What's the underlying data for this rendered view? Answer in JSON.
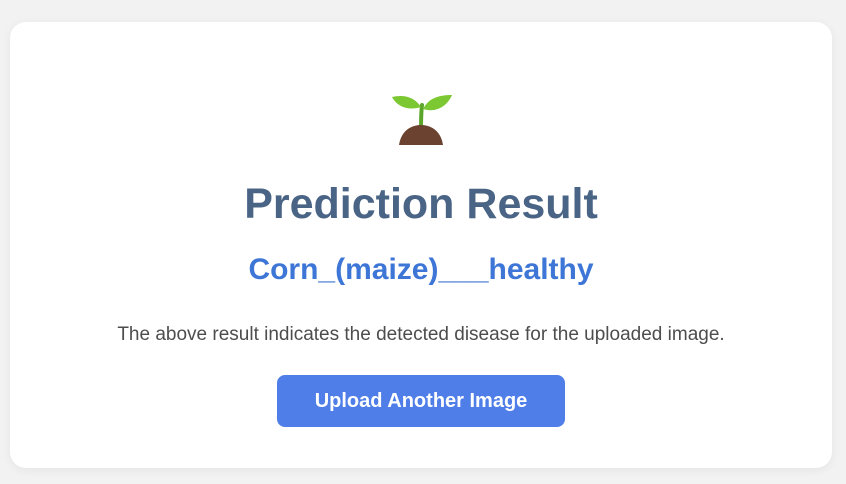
{
  "card": {
    "icon": "seedling-icon",
    "title": "Prediction Result",
    "result": "Corn_(maize)___healthy",
    "description": "The above result indicates the detected disease for the uploaded image.",
    "button_label": "Upload Another Image"
  },
  "colors": {
    "background": "#f2f2f2",
    "card": "#ffffff",
    "title": "#4a6486",
    "result": "#3d76d6",
    "description": "#4d4d4d",
    "button": "#4f7ee8",
    "leaf": "#7bc832",
    "soil": "#6b4230"
  }
}
